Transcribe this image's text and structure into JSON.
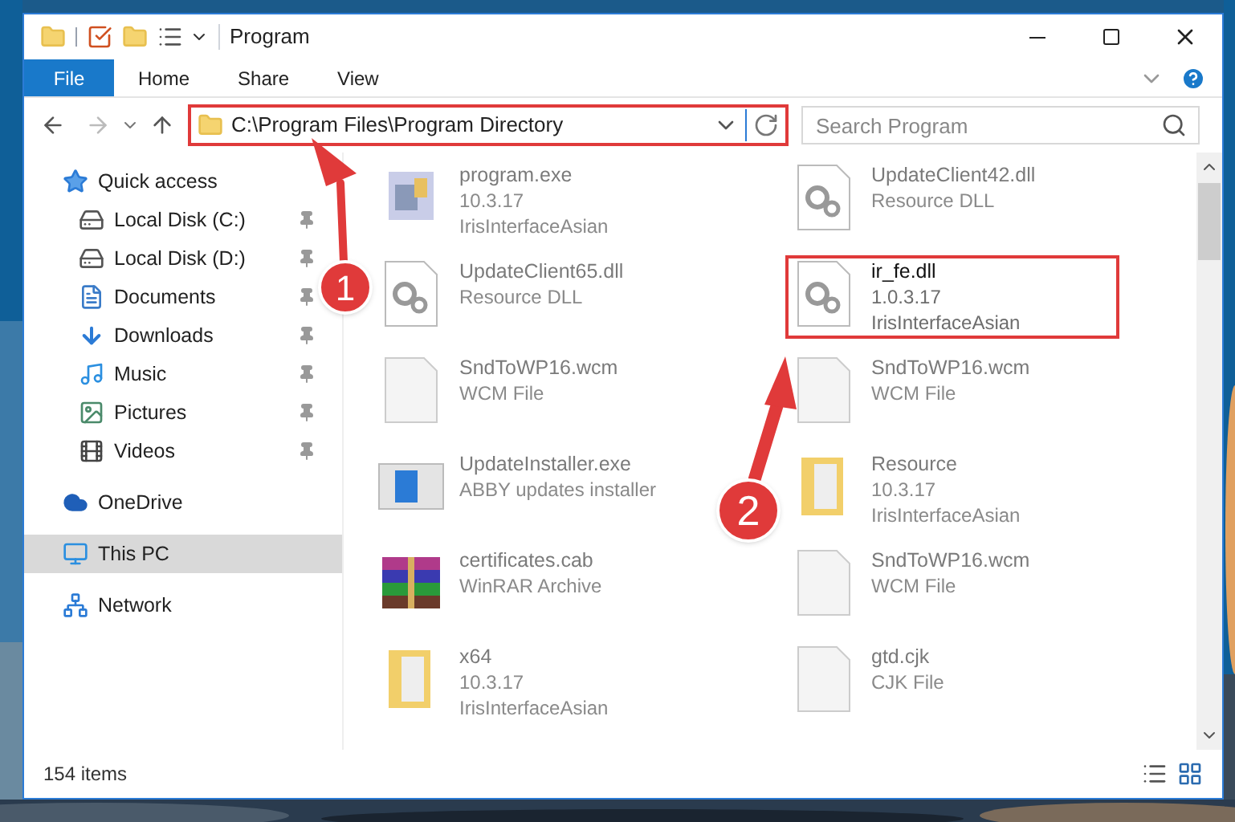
{
  "window": {
    "title": "Program"
  },
  "ribbon_tabs": [
    {
      "label": "File",
      "selected": true
    },
    {
      "label": "Home",
      "selected": false
    },
    {
      "label": "Share",
      "selected": false
    },
    {
      "label": "View",
      "selected": false
    }
  ],
  "address_bar": {
    "path": "C:\\Program Files\\Program Directory",
    "highlighted": true
  },
  "search": {
    "placeholder": "Search Program"
  },
  "sidebar": {
    "items": [
      {
        "label": "Quick access",
        "kind": "star",
        "pinned": false,
        "selected": false
      },
      {
        "label": "Local Disk (C:)",
        "kind": "diskc",
        "pinned": true,
        "selected": false
      },
      {
        "label": "Local Disk (D:)",
        "kind": "disk",
        "pinned": true,
        "selected": false
      },
      {
        "label": "Documents",
        "kind": "documents",
        "pinned": true,
        "selected": false
      },
      {
        "label": "Downloads",
        "kind": "downloads",
        "pinned": true,
        "selected": false
      },
      {
        "label": "Music",
        "kind": "music",
        "pinned": true,
        "selected": false
      },
      {
        "label": "Pictures",
        "kind": "pictures",
        "pinned": true,
        "selected": false
      },
      {
        "label": "Videos",
        "kind": "videos",
        "pinned": true,
        "selected": false
      },
      {
        "label": "OneDrive",
        "kind": "cloud",
        "pinned": false,
        "selected": false
      },
      {
        "label": "This PC",
        "kind": "pc",
        "pinned": false,
        "selected": true
      },
      {
        "label": "Network",
        "kind": "network",
        "pinned": false,
        "selected": false
      }
    ]
  },
  "files": [
    {
      "name": "program.exe",
      "lines": [
        "10.3.17",
        "IrisInterfaceAsian"
      ],
      "kind": "exe",
      "faded": true,
      "highlighted": false
    },
    {
      "name": "UpdateClient42.dll",
      "lines": [
        "Resource DLL"
      ],
      "kind": "dll",
      "faded": true,
      "highlighted": false
    },
    {
      "name": "UpdateClient65.dll",
      "lines": [
        "Resource DLL"
      ],
      "kind": "dll",
      "faded": true,
      "highlighted": false
    },
    {
      "name": "ir_fe.dll",
      "lines": [
        "1.0.3.17",
        "IrisInterfaceAsian"
      ],
      "kind": "dll",
      "faded": false,
      "highlighted": true
    },
    {
      "name": "SndToWP16.wcm",
      "lines": [
        "WCM File"
      ],
      "kind": "file",
      "faded": true,
      "highlighted": false
    },
    {
      "name": "SndToWP16.wcm",
      "lines": [
        "WCM File"
      ],
      "kind": "file",
      "faded": true,
      "highlighted": false
    },
    {
      "name": "UpdateInstaller.exe",
      "lines": [
        "ABBY updates installer"
      ],
      "kind": "installer",
      "faded": true,
      "highlighted": false
    },
    {
      "name": "Resource",
      "lines": [
        "10.3.17",
        "IrisInterfaceAsian"
      ],
      "kind": "folder",
      "faded": true,
      "highlighted": false
    },
    {
      "name": "certificates.cab",
      "lines": [
        "WinRAR Archive"
      ],
      "kind": "archive",
      "faded": true,
      "highlighted": false
    },
    {
      "name": "SndToWP16.wcm",
      "lines": [
        "WCM File"
      ],
      "kind": "file",
      "faded": true,
      "highlighted": false
    },
    {
      "name": "x64",
      "lines": [
        "10.3.17",
        "IrisInterfaceAsian"
      ],
      "kind": "folder",
      "faded": true,
      "highlighted": false
    },
    {
      "name": "gtd.cjk",
      "lines": [
        "CJK File"
      ],
      "kind": "file",
      "faded": true,
      "highlighted": false
    }
  ],
  "status_bar": {
    "count": "154 items"
  },
  "annotations": [
    {
      "label": "1"
    },
    {
      "label": "2"
    }
  ]
}
